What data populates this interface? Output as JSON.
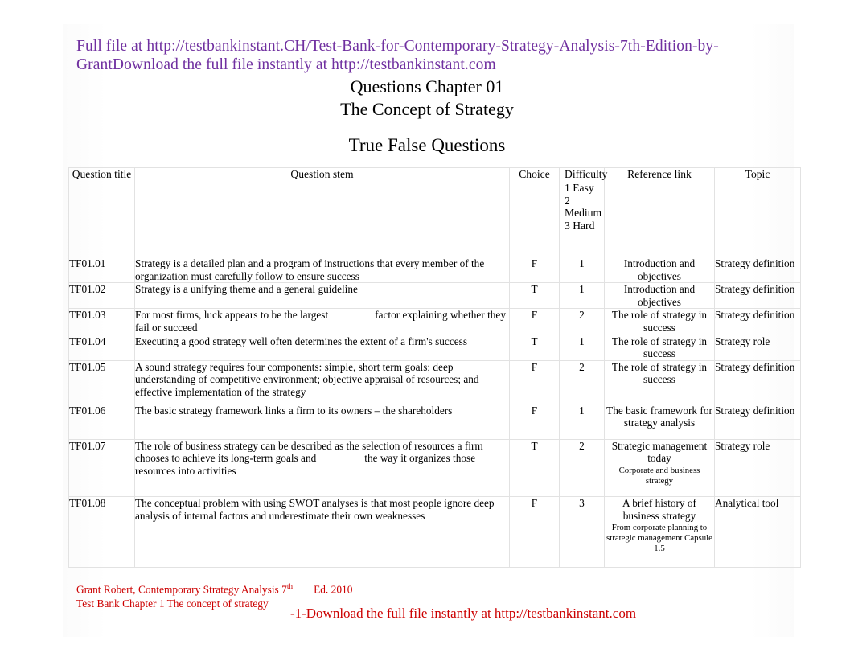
{
  "banner": {
    "text": "Full file at http://testbankinstant.CH/Test-Bank-for-Contemporary-Strategy-Analysis-7th-Edition-by-GrantDownload the full file instantly at http://testbankinstant.com",
    "color": "#7030A0"
  },
  "title": {
    "line1": "Questions Chapter 01",
    "line2": "The Concept of Strategy"
  },
  "section": {
    "heading": "True False Questions"
  },
  "table": {
    "headers": {
      "question_title": "Question title",
      "question_stem": "Question stem",
      "choice": "Choice",
      "difficulty": "Difficulty",
      "difficulty_scale": [
        "1 Easy",
        "2 Medium",
        "3 Hard"
      ],
      "reference_link": "Reference link",
      "topic": "Topic"
    },
    "rows": [
      {
        "title": "TF01.01",
        "stem_a": "Strategy is a detailed plan and a program of instructions that every member of the organization must carefully follow to ensure success",
        "choice": "F",
        "difficulty": "1",
        "reference": "Introduction and objectives",
        "reference_sub": "",
        "topic": "Strategy definition"
      },
      {
        "title": "TF01.02",
        "stem_a": "Strategy is a unifying theme and a general guideline",
        "choice": "T",
        "difficulty": "1",
        "reference": "Introduction and objectives",
        "reference_sub": "",
        "topic": "Strategy definition"
      },
      {
        "title": "TF01.03",
        "stem_a": "For most firms, luck appears to be the largest",
        "stem_b": "factor explaining whether they fail or succeed",
        "choice": "F",
        "difficulty": "2",
        "reference": "The role of strategy in success",
        "reference_sub": "",
        "topic": "Strategy definition"
      },
      {
        "title": "TF01.04",
        "stem_a": "Executing a good strategy well often determines the extent of a firm's success",
        "choice": "T",
        "difficulty": "1",
        "reference": "The role of strategy in success",
        "reference_sub": "",
        "topic": "Strategy role"
      },
      {
        "title": "TF01.05",
        "stem_a": "A sound strategy requires four components: simple, short term goals; deep understanding of competitive environment; objective appraisal of resources; and effective implementation of the strategy",
        "choice": "F",
        "difficulty": "2",
        "reference": "The role of strategy in success",
        "reference_sub": "",
        "topic": "Strategy definition"
      },
      {
        "title": "TF01.06",
        "stem_a": "The basic strategy framework links a firm to its owners – the shareholders",
        "choice": "F",
        "difficulty": "1",
        "reference": "The basic framework for strategy analysis",
        "reference_sub": "",
        "topic": "Strategy definition"
      },
      {
        "title": "TF01.07",
        "stem_a": "The role of business strategy can be described as the selection of resources a firm chooses to achieve its long-term goals and",
        "stem_b": "the way it organizes those resources into activities",
        "choice": "T",
        "difficulty": "2",
        "reference": "Strategic management today",
        "reference_sub": "Corporate and business strategy",
        "topic": "Strategy role"
      },
      {
        "title": "TF01.08",
        "stem_a": "The conceptual problem with using SWOT analyses is that most people ignore deep analysis of internal factors and underestimate their own weaknesses",
        "choice": "F",
        "difficulty": "3",
        "reference": "A brief history of business strategy",
        "reference_sub": "From corporate planning to strategic management Capsule 1.5",
        "topic": "Analytical tool"
      }
    ]
  },
  "footer": {
    "line1_a": "Grant Robert, Contemporary Strategy Analysis 7",
    "line1_sup": "th",
    "line1_b": "Ed. 2010",
    "line2": "Test Bank Chapter 1 The concept of strategy",
    "center": "-1-Download the full file instantly at http://testbankinstant.com",
    "color": "#CC0000"
  }
}
